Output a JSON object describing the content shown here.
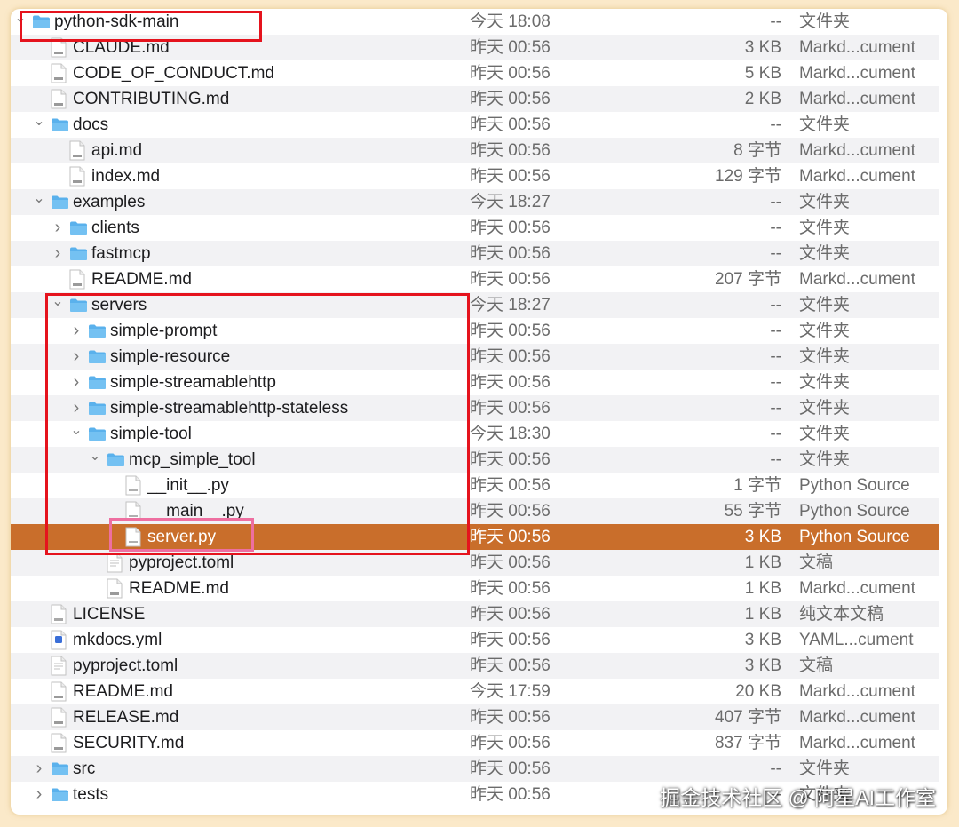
{
  "colors": {
    "selection": "#c96e2b",
    "highlight_red": "#e5131d",
    "highlight_pink": "#ee6fa0",
    "folder_blue": "#5ab1ec"
  },
  "rows": [
    {
      "name": "python-sdk-main",
      "date": "今天 18:08",
      "size": "--",
      "kind": "文件夹",
      "type": "folder",
      "depth": 0,
      "expander": "open"
    },
    {
      "name": "CLAUDE.md",
      "date": "昨天 00:56",
      "size": "3 KB",
      "kind": "Markd...cument",
      "type": "md",
      "depth": 1,
      "expander": "none"
    },
    {
      "name": "CODE_OF_CONDUCT.md",
      "date": "昨天 00:56",
      "size": "5 KB",
      "kind": "Markd...cument",
      "type": "md",
      "depth": 1,
      "expander": "none"
    },
    {
      "name": "CONTRIBUTING.md",
      "date": "昨天 00:56",
      "size": "2 KB",
      "kind": "Markd...cument",
      "type": "md",
      "depth": 1,
      "expander": "none"
    },
    {
      "name": "docs",
      "date": "昨天 00:56",
      "size": "--",
      "kind": "文件夹",
      "type": "folder",
      "depth": 1,
      "expander": "open"
    },
    {
      "name": "api.md",
      "date": "昨天 00:56",
      "size": "8 字节",
      "kind": "Markd...cument",
      "type": "md",
      "depth": 2,
      "expander": "none"
    },
    {
      "name": "index.md",
      "date": "昨天 00:56",
      "size": "129 字节",
      "kind": "Markd...cument",
      "type": "md",
      "depth": 2,
      "expander": "none"
    },
    {
      "name": "examples",
      "date": "今天 18:27",
      "size": "--",
      "kind": "文件夹",
      "type": "folder",
      "depth": 1,
      "expander": "open"
    },
    {
      "name": "clients",
      "date": "昨天 00:56",
      "size": "--",
      "kind": "文件夹",
      "type": "folder",
      "depth": 2,
      "expander": "closed"
    },
    {
      "name": "fastmcp",
      "date": "昨天 00:56",
      "size": "--",
      "kind": "文件夹",
      "type": "folder",
      "depth": 2,
      "expander": "closed"
    },
    {
      "name": "README.md",
      "date": "昨天 00:56",
      "size": "207 字节",
      "kind": "Markd...cument",
      "type": "md",
      "depth": 2,
      "expander": "none"
    },
    {
      "name": "servers",
      "date": "今天 18:27",
      "size": "--",
      "kind": "文件夹",
      "type": "folder",
      "depth": 2,
      "expander": "open"
    },
    {
      "name": "simple-prompt",
      "date": "昨天 00:56",
      "size": "--",
      "kind": "文件夹",
      "type": "folder",
      "depth": 3,
      "expander": "closed"
    },
    {
      "name": "simple-resource",
      "date": "昨天 00:56",
      "size": "--",
      "kind": "文件夹",
      "type": "folder",
      "depth": 3,
      "expander": "closed"
    },
    {
      "name": "simple-streamablehttp",
      "date": "昨天 00:56",
      "size": "--",
      "kind": "文件夹",
      "type": "folder",
      "depth": 3,
      "expander": "closed"
    },
    {
      "name": "simple-streamablehttp-stateless",
      "date": "昨天 00:56",
      "size": "--",
      "kind": "文件夹",
      "type": "folder",
      "depth": 3,
      "expander": "closed"
    },
    {
      "name": "simple-tool",
      "date": "今天 18:30",
      "size": "--",
      "kind": "文件夹",
      "type": "folder",
      "depth": 3,
      "expander": "open"
    },
    {
      "name": "mcp_simple_tool",
      "date": "昨天 00:56",
      "size": "--",
      "kind": "文件夹",
      "type": "folder",
      "depth": 4,
      "expander": "open"
    },
    {
      "name": "__init__.py",
      "date": "昨天 00:56",
      "size": "1 字节",
      "kind": "Python Source",
      "type": "py",
      "depth": 5,
      "expander": "none"
    },
    {
      "name": "__main__.py",
      "date": "昨天 00:56",
      "size": "55 字节",
      "kind": "Python Source",
      "type": "py",
      "depth": 5,
      "expander": "none"
    },
    {
      "name": "server.py",
      "date": "昨天 00:56",
      "size": "3 KB",
      "kind": "Python Source",
      "type": "py",
      "depth": 5,
      "expander": "none",
      "selected": true
    },
    {
      "name": "pyproject.toml",
      "date": "昨天 00:56",
      "size": "1 KB",
      "kind": "文稿",
      "type": "text",
      "depth": 4,
      "expander": "none"
    },
    {
      "name": "README.md",
      "date": "昨天 00:56",
      "size": "1 KB",
      "kind": "Markd...cument",
      "type": "md",
      "depth": 4,
      "expander": "none"
    },
    {
      "name": "LICENSE",
      "date": "昨天 00:56",
      "size": "1 KB",
      "kind": "纯文本文稿",
      "type": "txt",
      "depth": 1,
      "expander": "none"
    },
    {
      "name": "mkdocs.yml",
      "date": "昨天 00:56",
      "size": "3 KB",
      "kind": "YAML...cument",
      "type": "yml",
      "depth": 1,
      "expander": "none"
    },
    {
      "name": "pyproject.toml",
      "date": "昨天 00:56",
      "size": "3 KB",
      "kind": "文稿",
      "type": "text",
      "depth": 1,
      "expander": "none"
    },
    {
      "name": "README.md",
      "date": "今天 17:59",
      "size": "20 KB",
      "kind": "Markd...cument",
      "type": "md",
      "depth": 1,
      "expander": "none"
    },
    {
      "name": "RELEASE.md",
      "date": "昨天 00:56",
      "size": "407 字节",
      "kind": "Markd...cument",
      "type": "md",
      "depth": 1,
      "expander": "none"
    },
    {
      "name": "SECURITY.md",
      "date": "昨天 00:56",
      "size": "837 字节",
      "kind": "Markd...cument",
      "type": "md",
      "depth": 1,
      "expander": "none"
    },
    {
      "name": "src",
      "date": "昨天 00:56",
      "size": "--",
      "kind": "文件夹",
      "type": "folder",
      "depth": 1,
      "expander": "closed"
    },
    {
      "name": "tests",
      "date": "昨天 00:56",
      "size": "--",
      "kind": "文件夹",
      "type": "folder",
      "depth": 1,
      "expander": "closed"
    }
  ],
  "watermark": "掘金技术社区 @ 阿星AI工作室"
}
